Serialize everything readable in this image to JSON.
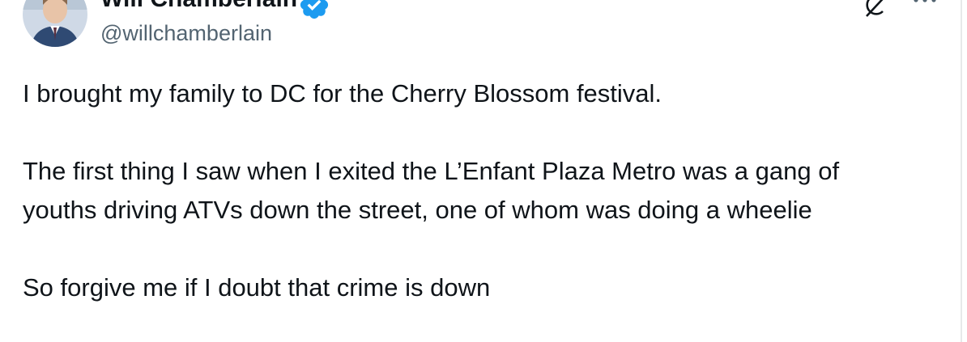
{
  "author": {
    "name": "Will Chamberlain",
    "handle": "@willchamberlain",
    "verified": true
  },
  "tweet": {
    "line1": "I brought my family to DC for the Cherry Blossom festival.",
    "line2": "The first thing I saw when I exited the L’Enfant Plaza Metro was a gang of",
    "line3": "youths driving ATVs down the street, one of whom was doing a wheelie",
    "line4": "So forgive me if I doubt that crime is down"
  },
  "colors": {
    "text": "#0f1419",
    "secondary": "#536471",
    "verified_badge": "#1d9bf0",
    "divider": "#e7e9ea"
  },
  "icons": {
    "verified": "verified-badge-icon",
    "grok": "grok-icon",
    "more": "more-icon"
  }
}
